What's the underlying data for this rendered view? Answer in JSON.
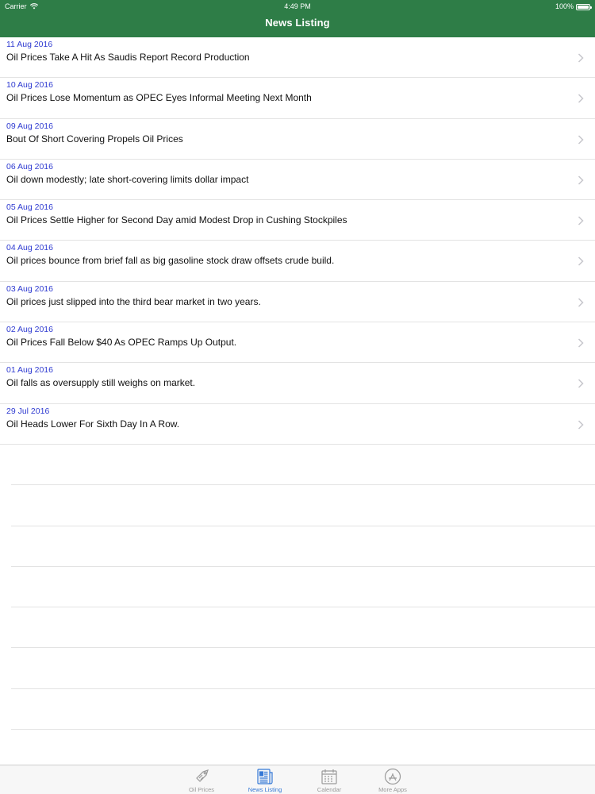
{
  "status_bar": {
    "carrier": "Carrier",
    "time": "4:49 PM",
    "battery": "100%"
  },
  "nav": {
    "title": "News Listing"
  },
  "news": [
    {
      "date": "11 Aug 2016",
      "title": "Oil Prices Take A Hit As Saudis Report Record Production"
    },
    {
      "date": "10 Aug 2016",
      "title": "Oil Prices Lose Momentum as OPEC Eyes Informal Meeting Next Month"
    },
    {
      "date": "09 Aug 2016",
      "title": "Bout Of Short Covering Propels Oil Prices"
    },
    {
      "date": "06 Aug 2016",
      "title": "Oil down modestly; late short-covering limits dollar impact"
    },
    {
      "date": "05 Aug 2016",
      "title": "Oil Prices Settle Higher for Second Day amid Modest Drop in Cushing Stockpiles"
    },
    {
      "date": "04 Aug 2016",
      "title": "Oil prices bounce from brief fall as big gasoline stock draw offsets crude build."
    },
    {
      "date": "03 Aug 2016",
      "title": "Oil prices just slipped into the third bear market in two years."
    },
    {
      "date": "02 Aug 2016",
      "title": "Oil Prices Fall Below $40 As OPEC Ramps Up Output."
    },
    {
      "date": "01 Aug 2016",
      "title": "Oil falls as oversupply still weighs on market."
    },
    {
      "date": "29 Jul 2016",
      "title": "Oil Heads Lower For Sixth Day In A Row."
    }
  ],
  "tabs": [
    {
      "label": "Oil Prices",
      "icon": "price-tag-icon",
      "active": false
    },
    {
      "label": "News Listing",
      "icon": "newspaper-icon",
      "active": true
    },
    {
      "label": "Calendar",
      "icon": "calendar-icon",
      "active": false
    },
    {
      "label": "More Apps",
      "icon": "app-store-icon",
      "active": false
    }
  ],
  "colors": {
    "header_green": "#2e7d47",
    "date_blue": "#2f3bd1",
    "tab_active": "#3478d6",
    "tab_inactive": "#9a9a9a"
  }
}
